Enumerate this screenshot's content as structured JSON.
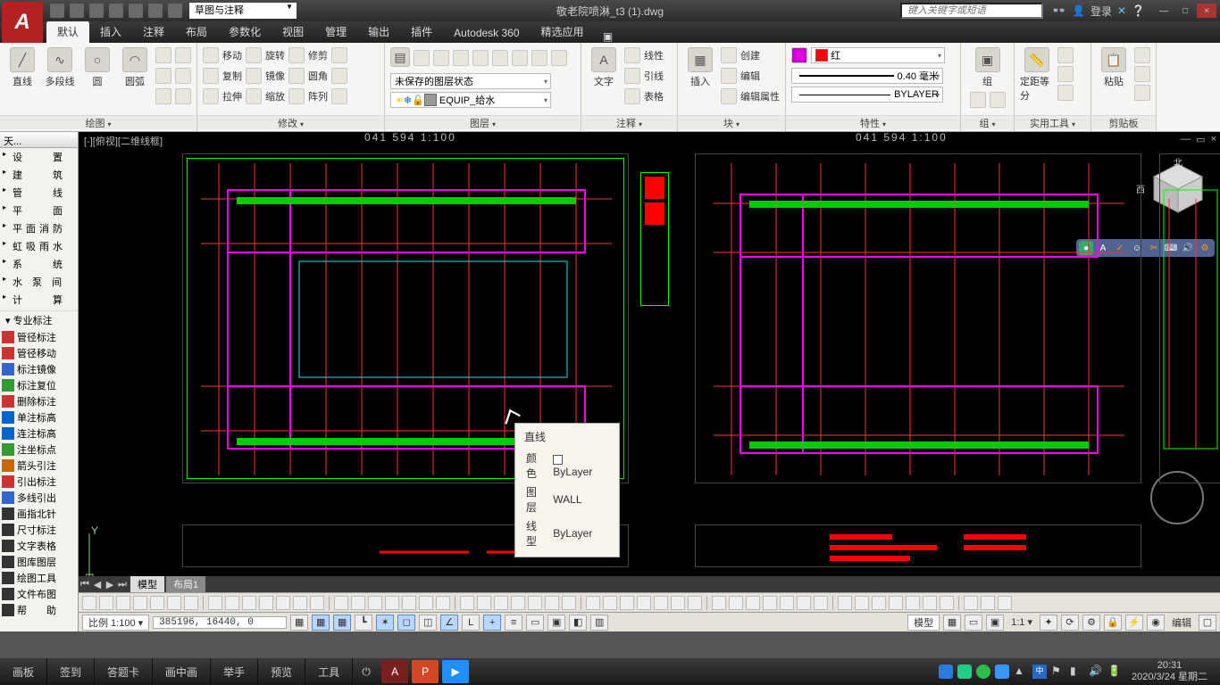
{
  "titlebar": {
    "logo": "A",
    "workspace": "草图与注释",
    "doc_title": "敬老院喷淋_t3 (1).dwg",
    "search_placeholder": "键入关键字或短语",
    "login": "登录",
    "minimize": "—",
    "maximize": "□",
    "close": "×"
  },
  "tabs": [
    "默认",
    "插入",
    "注释",
    "布局",
    "参数化",
    "视图",
    "管理",
    "输出",
    "插件",
    "Autodesk 360",
    "精选应用"
  ],
  "active_tab": "默认",
  "ribbon": {
    "draw": {
      "title": "绘图",
      "line": "直线",
      "polyline": "多段线",
      "circle": "圆",
      "arc": "圆弧"
    },
    "modify": {
      "title": "修改",
      "move": "移动",
      "rotate": "旋转",
      "trim": "修剪",
      "copy": "复制",
      "mirror": "镜像",
      "fillet": "圆角",
      "stretch": "拉伸",
      "scale": "缩放",
      "array": "阵列"
    },
    "layers": {
      "title": "图层",
      "state": "未保存的图层状态",
      "current": "EQUIP_给水"
    },
    "annotate": {
      "title": "注释",
      "text": "文字",
      "linear": "线性",
      "leader": "引线",
      "table": "表格"
    },
    "block": {
      "title": "块",
      "insert": "插入",
      "create": "创建",
      "edit": "编辑",
      "attr": "编辑属性"
    },
    "props": {
      "title": "特性",
      "color_label": "红",
      "lw": "0.40 毫米",
      "lt": "BYLAYER",
      "color": "#ff0000"
    },
    "group": {
      "title": "组",
      "label": "组"
    },
    "util": {
      "title": "实用工具",
      "measure": "定距等分"
    },
    "clip": {
      "title": "剪贴板",
      "paste": "粘贴"
    }
  },
  "tree": {
    "title": "天...",
    "base": [
      "设　　置",
      "建　　筑",
      "管　　线",
      "平　　面",
      "平面消防",
      "虹吸雨水",
      "系　　统",
      "水 泵 间",
      "计　　算"
    ],
    "sec_label": "专业标注",
    "annot": [
      "管径标注",
      "管径移动",
      "标注镜像",
      "标注复位",
      "删除标注",
      "单注标高",
      "连注标高",
      "注坐标点",
      "箭头引注",
      "引出标注",
      "多线引出",
      "画指北针",
      "尺寸标注",
      "文字表格",
      "图库图层",
      "绘图工具",
      "文件布图",
      "帮　　助"
    ]
  },
  "view": {
    "label": "[-][俯视][二维线框]",
    "hdr1": "041 594  1:100",
    "hdr2": "041 594  1:100",
    "nav_n": "北",
    "nav_w": "西",
    "restore": "▭",
    "min": "—",
    "close": "×"
  },
  "tooltip": {
    "title": "直线",
    "rows": [
      {
        "k": "颜色",
        "v": "ByLayer",
        "sw": true
      },
      {
        "k": "图层",
        "v": "WALL"
      },
      {
        "k": "线型",
        "v": "ByLayer"
      }
    ]
  },
  "layout_tabs": {
    "model": "模型",
    "layout1": "布局1"
  },
  "status": {
    "scale_label": "比例 1:100 ▾",
    "coords": "385196, 16440, 0",
    "model": "模型",
    "anno": "1:1 ▾",
    "edit": "编辑"
  },
  "taskbar": {
    "items": [
      "画板",
      "签到",
      "答题卡",
      "画中画",
      "举手",
      "预览",
      "工具"
    ],
    "clock": "20:31",
    "date": "2020/3/24 星期二"
  }
}
